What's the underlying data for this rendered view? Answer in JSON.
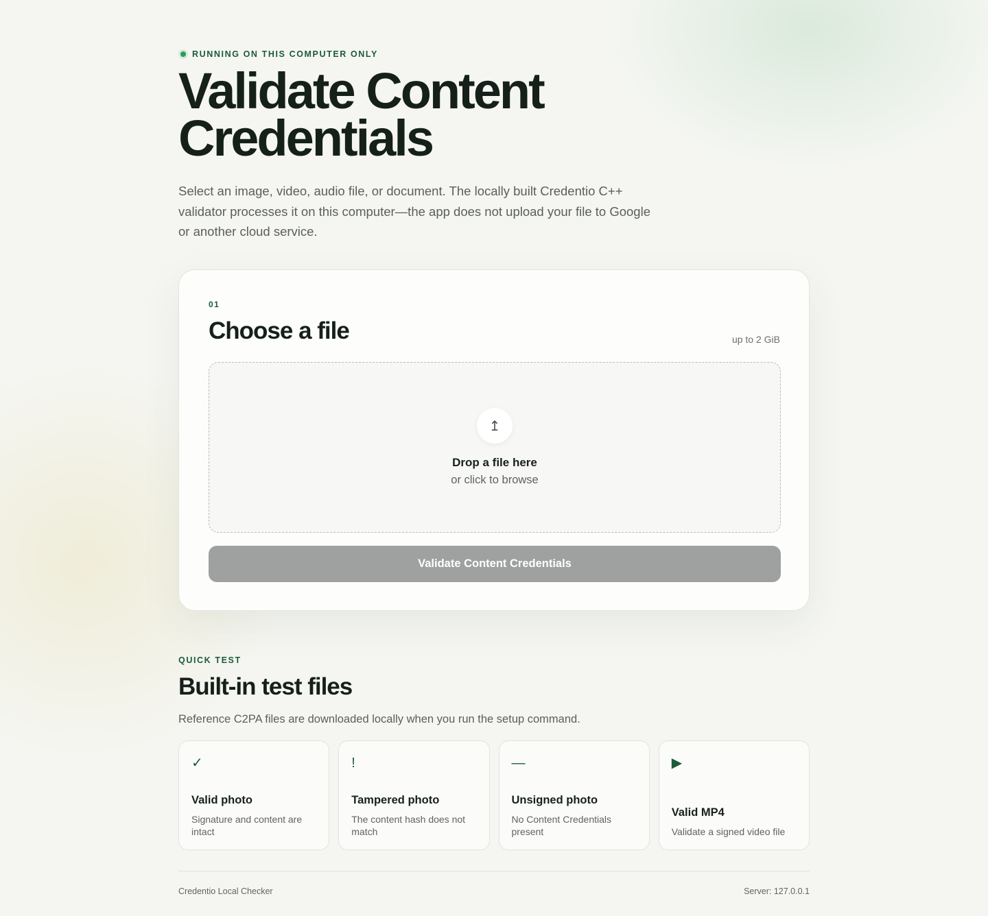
{
  "header": {
    "badge": "RUNNING ON THIS COMPUTER ONLY",
    "title": "Validate Content Credentials",
    "subtitle": "Select an image, video, audio file, or document. The locally built Credentio C++ validator processes it on this computer—the app does not upload your file to Google or another cloud service."
  },
  "upload_card": {
    "step": "01",
    "title": "Choose a file",
    "limit": "up to 2 GiB",
    "drop_main": "Drop a file here",
    "drop_sub": "or click to browse",
    "button": "Validate Content Credentials"
  },
  "quick_test": {
    "label": "QUICK TEST",
    "title": "Built-in test files",
    "subtitle": "Reference C2PA files are downloaded locally when you run the setup command.",
    "tiles": [
      {
        "icon": "✓",
        "icon_name": "check-icon",
        "title": "Valid photo",
        "desc": "Signature and content are intact"
      },
      {
        "icon": "!",
        "icon_name": "exclamation-icon",
        "title": "Tampered photo",
        "desc": "The content hash does not match"
      },
      {
        "icon": "—",
        "icon_name": "dash-icon",
        "title": "Unsigned photo",
        "desc": "No Content Credentials present"
      },
      {
        "icon": "▶",
        "icon_name": "play-icon",
        "title": "Valid MP4",
        "desc": "Validate a signed video file"
      }
    ]
  },
  "footer": {
    "left": "Credentio Local Checker",
    "right": "Server: 127.0.0.1"
  },
  "colors": {
    "accent": "#1c5a3a",
    "status_dot": "#2f9c5a",
    "button_disabled": "#9ea19f"
  }
}
